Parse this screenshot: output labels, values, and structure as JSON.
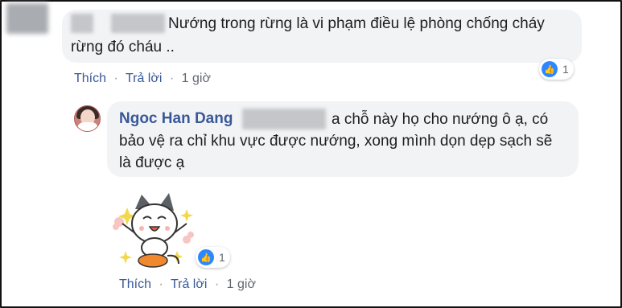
{
  "comments": [
    {
      "text_line1": "Nướng trong rừng là vi phạm điều lệ phòng chống cháy",
      "text_line2": "rừng đó cháu ..",
      "actions": {
        "like": "Thích",
        "reply": "Trả lời",
        "time": "1 giờ"
      },
      "reaction_count": "1"
    },
    {
      "author": "Ngoc Han Dang",
      "text_line1": "a chỗ này họ cho nướng ô ạ, có",
      "text_line2": "bảo vệ ra chỉ khu vực được nướng, xong mình dọn dẹp sạch sẽ",
      "text_line3": "là được ạ"
    },
    {
      "actions": {
        "like": "Thích",
        "reply": "Trả lời",
        "time": "1 giờ"
      },
      "reaction_count": "1"
    }
  ],
  "separator": "·",
  "icons": {
    "reaction": "like-icon",
    "sticker": "cat-sticker-icon"
  },
  "colors": {
    "link": "#385898",
    "bubble": "#f2f3f5",
    "like": "#2d88ff"
  }
}
